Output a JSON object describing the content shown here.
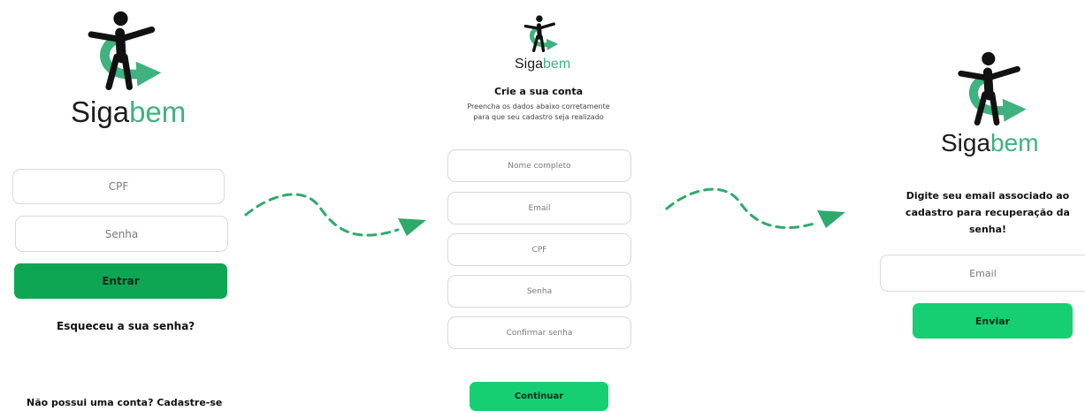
{
  "brand": {
    "name_part1": "Siga",
    "name_part2": "bem"
  },
  "login": {
    "cpf_placeholder": "CPF",
    "password_placeholder": "Senha",
    "login_button": "Entrar",
    "forgot_password_link": "Esqueceu a sua senha?",
    "signup_link": "Não possui uma conta? Cadastre-se"
  },
  "signup": {
    "title": "Crie a sua conta",
    "subtitle_line1": "Preencha os dados abaixo corretamente",
    "subtitle_line2": "para que seu cadastro seja realizado",
    "name_placeholder": "Nome completo",
    "email_placeholder": "Email",
    "cpf_placeholder": "CPF",
    "password_placeholder": "Senha",
    "confirm_password_placeholder": "Confirmar senha",
    "continue_button": "Continuar"
  },
  "recovery": {
    "heading_line1": "Digite seu email associado ao",
    "heading_line2": "cadastro para recuperação da",
    "heading_line3": "senha!",
    "email_placeholder": "Email",
    "send_button": "Enviar"
  },
  "colors": {
    "brand_green": "#3fb27f",
    "button_green_dark": "#0ea653",
    "button_green_light": "#16cf73",
    "arrow_green": "#2eaa6a"
  },
  "icons": [
    "person-arrow-logo-icon",
    "dashed-flow-arrow-icon"
  ]
}
